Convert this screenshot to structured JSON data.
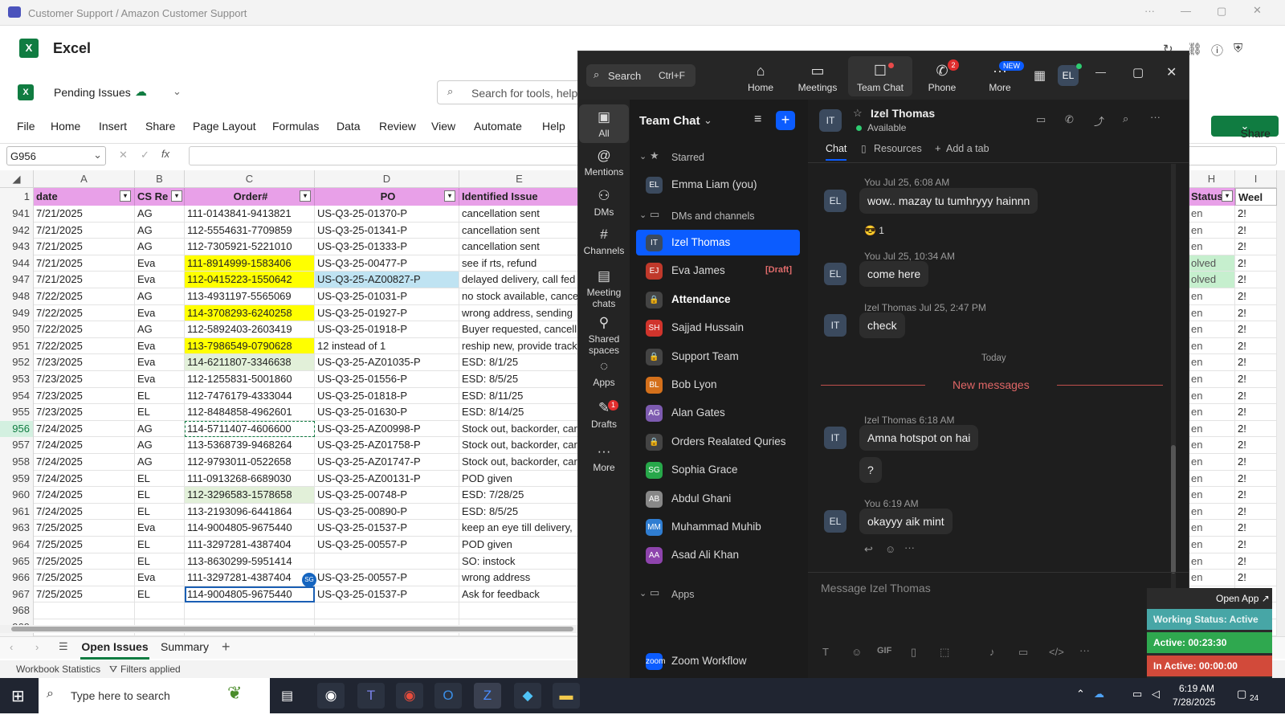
{
  "window": {
    "title": "Customer Support / Amazon Customer Support"
  },
  "app": {
    "name": "Excel"
  },
  "workbook": {
    "name": "Pending Issues",
    "search_placeholder": "Search for tools, help,"
  },
  "ribbon": [
    "File",
    "Home",
    "Insert",
    "Share",
    "Page Layout",
    "Formulas",
    "Data",
    "Review",
    "View",
    "Automate",
    "Help"
  ],
  "namebox": "G956",
  "columns": [
    "A",
    "B",
    "C",
    "D",
    "E",
    "H",
    "I"
  ],
  "headers": {
    "date": "date",
    "cs": "CS Re",
    "order": "Order#",
    "po": "PO",
    "issue": "Identified Issue",
    "status": "Status",
    "week": "Weel"
  },
  "rows": [
    {
      "n": "941",
      "date": "7/21/2025",
      "cs": "AG",
      "order": "111-0143841-9413821",
      "po": "US-Q3-25-01370-P",
      "issue": "cancellation sent",
      "h": "en",
      "hl": ""
    },
    {
      "n": "942",
      "date": "7/21/2025",
      "cs": "AG",
      "order": "112-5554631-7709859",
      "po": "US-Q3-25-01341-P",
      "issue": "cancellation sent",
      "h": "en",
      "hl": ""
    },
    {
      "n": "943",
      "date": "7/21/2025",
      "cs": "AG",
      "order": "112-7305921-5221010",
      "po": "US-Q3-25-01333-P",
      "issue": "cancellation sent",
      "h": "en",
      "hl": ""
    },
    {
      "n": "944",
      "date": "7/21/2025",
      "cs": "Eva",
      "order": "111-8914999-1583406",
      "po": "US-Q3-25-00477-P",
      "issue": "see if rts, refund",
      "h": "olved",
      "hl": "yellow"
    },
    {
      "n": "947",
      "date": "7/21/2025",
      "cs": "Eva",
      "order": "112-0415223-1550642",
      "po": "US-Q3-25-AZ00827-P",
      "issue": "delayed delivery, call fed",
      "h": "olved",
      "hl": "yellowblue"
    },
    {
      "n": "948",
      "date": "7/22/2025",
      "cs": "AG",
      "order": "113-4931197-5565069",
      "po": "US-Q3-25-01031-P",
      "issue": "no stock available, cance",
      "h": "en",
      "hl": ""
    },
    {
      "n": "949",
      "date": "7/22/2025",
      "cs": "Eva",
      "order": "114-3708293-6240258",
      "po": "US-Q3-25-01927-P",
      "issue": "wrong address, sending",
      "h": "en",
      "hl": "yellow"
    },
    {
      "n": "950",
      "date": "7/22/2025",
      "cs": "AG",
      "order": "112-5892403-2603419",
      "po": "US-Q3-25-01918-P",
      "issue": "Buyer requested, cancell",
      "h": "en",
      "hl": ""
    },
    {
      "n": "951",
      "date": "7/22/2025",
      "cs": "Eva",
      "order": "113-7986549-0790628",
      "po": "12 instead of 1",
      "issue": "reship new, provide track",
      "h": "en",
      "hl": "yellow"
    },
    {
      "n": "952",
      "date": "7/23/2025",
      "cs": "Eva",
      "order": "114-6211807-3346638",
      "po": "US-Q3-25-AZ01035-P",
      "issue": " ESD: 8/1/25",
      "h": "en",
      "hl": "green"
    },
    {
      "n": "953",
      "date": "7/23/2025",
      "cs": "Eva",
      "order": "112-1255831-5001860",
      "po": "US-Q3-25-01556-P",
      "issue": "ESD:  8/5/25",
      "h": "en",
      "hl": ""
    },
    {
      "n": "954",
      "date": "7/23/2025",
      "cs": "EL",
      "order": "112-7476179-4333044",
      "po": "US-Q3-25-01818-P",
      "issue": "ESD: 8/11/25",
      "h": "en",
      "hl": ""
    },
    {
      "n": "955",
      "date": "7/23/2025",
      "cs": "EL",
      "order": "112-8484858-4962601",
      "po": "US-Q3-25-01630-P",
      "issue": " ESD: 8/14/25",
      "h": "en",
      "hl": ""
    },
    {
      "n": "956",
      "date": "7/24/2025",
      "cs": "AG",
      "order": "114-5711407-4606600",
      "po": "US-Q3-25-AZ00998-P",
      "issue": "Stock out, backorder, car",
      "h": "en",
      "hl": "sel"
    },
    {
      "n": "957",
      "date": "7/24/2025",
      "cs": "AG",
      "order": "113-5368739-9468264",
      "po": "US-Q3-25-AZ01758-P",
      "issue": "Stock out, backorder, car",
      "h": "en",
      "hl": ""
    },
    {
      "n": "958",
      "date": "7/24/2025",
      "cs": "AG",
      "order": "112-9793011-0522658",
      "po": "US-Q3-25-AZ01747-P",
      "issue": "Stock out, backorder, car",
      "h": "en",
      "hl": ""
    },
    {
      "n": "959",
      "date": "7/24/2025",
      "cs": "EL",
      "order": "111-0913268-6689030",
      "po": "US-Q3-25-AZ00131-P",
      "issue": "POD given",
      "h": "en",
      "hl": ""
    },
    {
      "n": "960",
      "date": "7/24/2025",
      "cs": "EL",
      "order": "112-3296583-1578658",
      "po": "US-Q3-25-00748-P",
      "issue": "ESD: 7/28/25",
      "h": "en",
      "hl": "green"
    },
    {
      "n": "961",
      "date": "7/24/2025",
      "cs": "EL",
      "order": "113-2193096-6441864",
      "po": "US-Q3-25-00890-P",
      "issue": "ESD: 8/5/25",
      "h": "en",
      "hl": ""
    },
    {
      "n": "963",
      "date": "7/25/2025",
      "cs": "Eva",
      "order": "114-9004805-9675440",
      "po": "US-Q3-25-01537-P",
      "issue": "keep an eye till delivery,",
      "h": "en",
      "hl": ""
    },
    {
      "n": "964",
      "date": "7/25/2025",
      "cs": "EL",
      "order": "111-3297281-4387404",
      "po": "US-Q3-25-00557-P",
      "issue": "POD given",
      "h": "en",
      "hl": ""
    },
    {
      "n": "965",
      "date": "7/25/2025",
      "cs": "EL",
      "order": "113-8630299-5951414",
      "po": "",
      "issue": "SO: instock",
      "h": "en",
      "hl": ""
    },
    {
      "n": "966",
      "date": "7/25/2025",
      "cs": "Eva",
      "order": "111-3297281-4387404",
      "po": "US-Q3-25-00557-P",
      "issue": "wrong address",
      "h": "en",
      "hl": ""
    },
    {
      "n": "967",
      "date": "7/25/2025",
      "cs": "EL",
      "order": "114-9004805-9675440",
      "po": "US-Q3-25-01537-P",
      "issue": "Ask for feedback",
      "h": "",
      "hl": "box"
    },
    {
      "n": "968",
      "date": "",
      "cs": "",
      "order": "",
      "po": "",
      "issue": "",
      "h": "",
      "hl": ""
    },
    {
      "n": "969",
      "date": "",
      "cs": "",
      "order": "",
      "po": "",
      "issue": "",
      "h": "",
      "hl": ""
    }
  ],
  "week_val": "2!",
  "sheets": {
    "active": "Open Issues",
    "other": "Summary"
  },
  "status": {
    "stats": "Workbook Statistics",
    "filters": "Filters applied"
  },
  "share": "Share",
  "zoom": {
    "search": "Search",
    "shortcut": "Ctrl+F",
    "tabs": [
      {
        "label": "Home",
        "icon": "⌂"
      },
      {
        "label": "Meetings",
        "icon": "▭"
      },
      {
        "label": "Team Chat",
        "icon": "☐"
      },
      {
        "label": "Phone",
        "icon": "✆",
        "badge": "2"
      },
      {
        "label": "More",
        "icon": "···",
        "badge": "NEW"
      }
    ],
    "avatar": "EL",
    "rail": [
      {
        "label": "All",
        "icon": "▣"
      },
      {
        "label": "Mentions",
        "icon": "@"
      },
      {
        "label": "DMs",
        "icon": "⚇"
      },
      {
        "label": "Channels",
        "icon": "#"
      },
      {
        "label": "Meeting chats",
        "icon": "▤"
      },
      {
        "label": "Shared spaces",
        "icon": "⚲"
      },
      {
        "label": "Apps",
        "icon": "◌"
      },
      {
        "label": "Drafts",
        "icon": "✎",
        "badge": "1"
      },
      {
        "label": "More",
        "icon": "···"
      }
    ],
    "list_title": "Team Chat",
    "sections": {
      "starred": "Starred",
      "dms": "DMs and channels",
      "apps": "Apps"
    },
    "starred": [
      {
        "av": "EL",
        "name": "Emma Liam (you)",
        "color": "#3b4a5e"
      }
    ],
    "items": [
      {
        "av": "IT",
        "name": "Izel Thomas",
        "color": "#3b4a5e",
        "active": true
      },
      {
        "av": "EJ",
        "name": "Eva James",
        "color": "#c0392b",
        "draft": "[Draft]"
      },
      {
        "av": "🔒",
        "name": "Attendance",
        "color": "#444",
        "bold": true
      },
      {
        "av": "SH",
        "name": "Sajjad Hussain",
        "color": "#d0342c"
      },
      {
        "av": "🔒",
        "name": "Support Team",
        "color": "#444"
      },
      {
        "av": "BL",
        "name": "Bob Lyon",
        "color": "#d4701b"
      },
      {
        "av": "AG",
        "name": "Alan Gates",
        "color": "#7d5bb0"
      },
      {
        "av": "🔒",
        "name": "Orders Realated Quries",
        "color": "#444"
      },
      {
        "av": "SG",
        "name": "Sophia Grace",
        "color": "#27a84a"
      },
      {
        "av": "AB",
        "name": "Abdul Ghani",
        "color": "#888"
      },
      {
        "av": "MM",
        "name": "Muhammad Muhib",
        "color": "#2f7dd1"
      },
      {
        "av": "AA",
        "name": "Asad Ali Khan",
        "color": "#8e44ad"
      }
    ],
    "apps": [
      {
        "av": "zoom",
        "name": "Zoom Workflow",
        "color": "#0b5cff"
      }
    ],
    "chat": {
      "name": "Izel Thomas",
      "status": "Available",
      "tab_chat": "Chat",
      "tab_resources": "Resources",
      "tab_add": "Add a tab",
      "today": "Today",
      "new_messages": "New messages",
      "placeholder": "Message Izel Thomas",
      "m1_meta": "You Jul 25, 6:08 AM",
      "m1": "wow.. mazay tu tumhryyy hainnn",
      "react": "😎 1",
      "m2_meta": "You Jul 25, 10:34 AM",
      "m2": "come here",
      "m3_meta": "Izel Thomas Jul 25, 2:47 PM",
      "m3": "check",
      "m4_meta": "Izel Thomas 6:18 AM",
      "m4": "Amna hotspot on hai",
      "m5": "?",
      "m6_meta": "You 6:19 AM",
      "m6": "okayyy aik mint"
    }
  },
  "widget": {
    "open": "Open App ↗",
    "working": "Working Status: Active",
    "active": "Active: 00:23:30",
    "inactive": "In Active: 00:00:00"
  },
  "taskbar": {
    "search": "Type here to search",
    "time": "6:19 AM",
    "date": "7/28/2025",
    "notif": "24"
  }
}
